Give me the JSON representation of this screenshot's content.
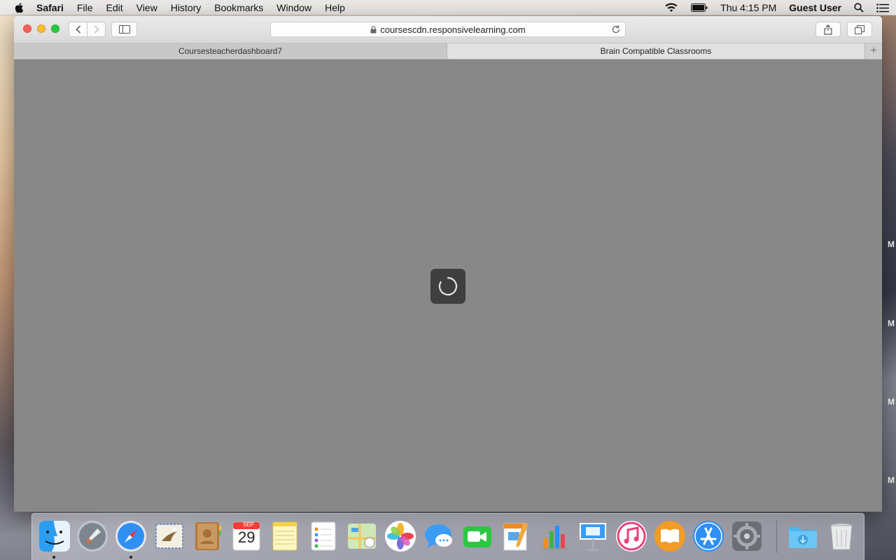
{
  "menubar": {
    "app_name": "Safari",
    "menus": [
      "File",
      "Edit",
      "View",
      "History",
      "Bookmarks",
      "Window",
      "Help"
    ],
    "clock": "Thu 4:15 PM",
    "user": "Guest User"
  },
  "browser": {
    "url": "coursescdn.responsivelearning.com",
    "tabs": [
      {
        "title": "Coursesteacherdashboard7",
        "active": false
      },
      {
        "title": "Brain Compatible Classrooms",
        "active": true
      }
    ],
    "new_tab_symbol": "+"
  },
  "desktop": {
    "edge_letters": [
      "M",
      "M",
      "M",
      "M"
    ]
  },
  "dock": {
    "calendar_month": "SEP",
    "calendar_day": "29",
    "apps": [
      "finder-icon",
      "launchpad-icon",
      "safari-icon",
      "mail-icon",
      "contacts-icon",
      "calendar-icon",
      "notes-icon",
      "reminders-icon",
      "maps-icon",
      "photos-icon",
      "messages-icon",
      "facetime-icon",
      "pages-icon",
      "numbers-icon",
      "keynote-icon",
      "itunes-icon",
      "ibooks-icon",
      "app-store-icon",
      "system-preferences-icon",
      "downloads-folder-icon",
      "trash-icon"
    ]
  },
  "colors": {
    "close": "#fc5f57",
    "minimize": "#fdbc2e",
    "maximize": "#28c840",
    "page_background": "#888888"
  }
}
